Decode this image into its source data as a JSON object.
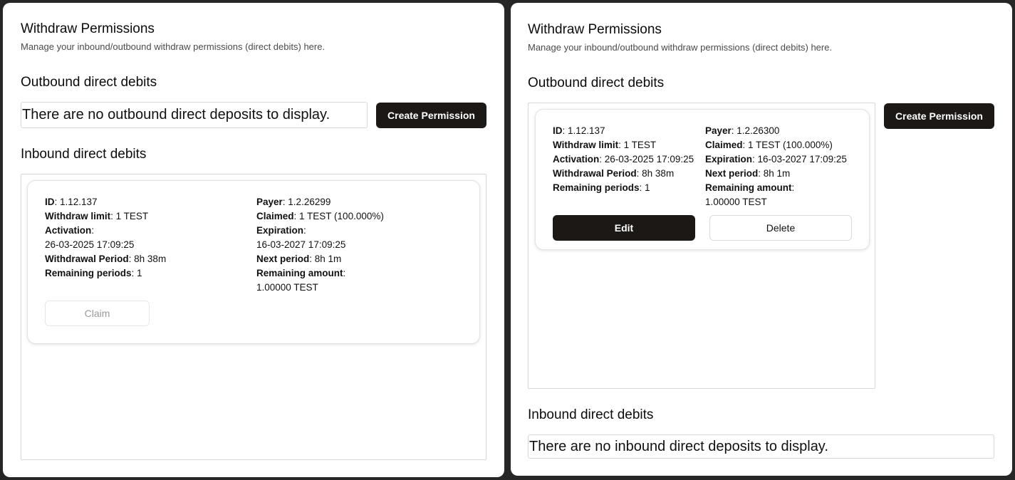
{
  "left": {
    "title": "Withdraw Permissions",
    "subtitle": "Manage your inbound/outbound withdraw permissions (direct debits) here.",
    "outbound_heading": "Outbound direct debits",
    "outbound_empty": "There are no outbound direct deposits to display.",
    "create_button": "Create Permission",
    "inbound_heading": "Inbound direct debits",
    "card": {
      "id_label": "ID",
      "id_value": ": 1.12.137",
      "withdraw_limit_label": "Withdraw limit",
      "withdraw_limit_value": ": 1 TEST",
      "activation_label": "Activation",
      "activation_value": ":",
      "activation_date": "26-03-2025 17:09:25",
      "withdrawal_period_label": "Withdrawal Period",
      "withdrawal_period_value": ": 8h 38m",
      "remaining_periods_label": "Remaining periods",
      "remaining_periods_value": ": 1",
      "payer_label": "Payer",
      "payer_value": ": 1.2.26299",
      "claimed_label": "Claimed",
      "claimed_value": ": 1 TEST (100.000%)",
      "expiration_label": "Expiration",
      "expiration_value": ":",
      "expiration_date": "16-03-2027 17:09:25",
      "next_period_label": "Next period",
      "next_period_value": ": 8h 1m",
      "remaining_amount_label": "Remaining amount",
      "remaining_amount_value": ":",
      "remaining_amount_amount": "1.00000 TEST",
      "claim_button": "Claim"
    }
  },
  "right": {
    "title": "Withdraw Permissions",
    "subtitle": "Manage your inbound/outbound withdraw permissions (direct debits) here.",
    "outbound_heading": "Outbound direct debits",
    "create_button": "Create Permission",
    "card": {
      "id_label": "ID",
      "id_value": ": 1.12.137",
      "withdraw_limit_label": "Withdraw limit",
      "withdraw_limit_value": ": 1 TEST",
      "activation_label": "Activation",
      "activation_value": ": 26-03-2025 17:09:25",
      "withdrawal_period_label": "Withdrawal Period",
      "withdrawal_period_value": ": 8h 38m",
      "remaining_periods_label": "Remaining periods",
      "remaining_periods_value": ": 1",
      "payer_label": "Payer",
      "payer_value": ": 1.2.26300",
      "claimed_label": "Claimed",
      "claimed_value": ": 1 TEST (100.000%)",
      "expiration_label": "Expiration",
      "expiration_value": ": 16-03-2027 17:09:25",
      "next_period_label": "Next period",
      "next_period_value": ": 8h 1m",
      "remaining_amount_label": "Remaining amount",
      "remaining_amount_value": ":",
      "remaining_amount_amount": "1.00000 TEST",
      "edit_button": "Edit",
      "delete_button": "Delete"
    },
    "inbound_heading": "Inbound direct debits",
    "inbound_empty": "There are no inbound direct deposits to display."
  }
}
